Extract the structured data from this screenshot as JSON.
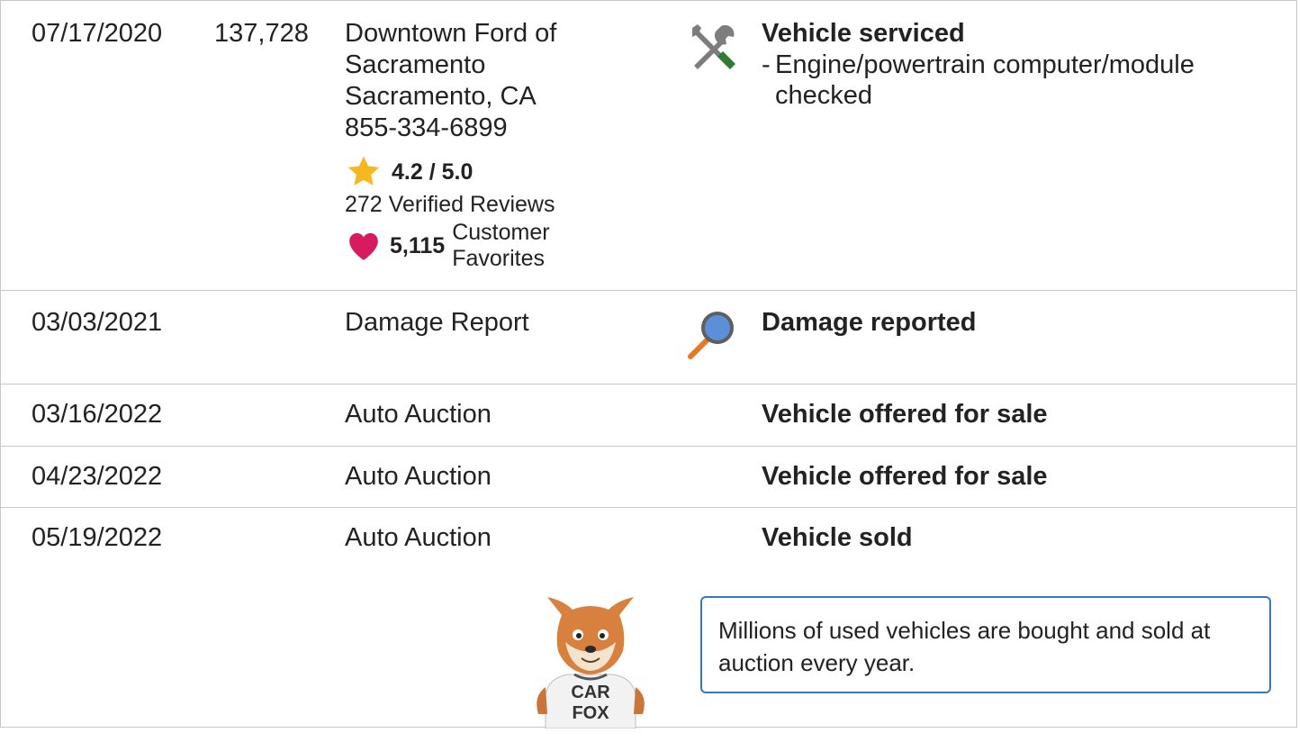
{
  "rows": [
    {
      "date": "07/17/2020",
      "mileage": "137,728",
      "source": {
        "name_line1": "Downtown Ford of",
        "name_line2": "Sacramento",
        "location": "Sacramento, CA",
        "phone": "855-334-6899",
        "rating": "4.2 / 5.0",
        "reviews": "272 Verified Reviews",
        "favorites_count": "5,115",
        "favorites_label_1": "Customer",
        "favorites_label_2": "Favorites"
      },
      "icon": "wrench-screwdriver-icon",
      "title": "Vehicle serviced",
      "detail_dash": "-",
      "detail": "Engine/powertrain computer/module checked"
    },
    {
      "date": "03/03/2021",
      "mileage": "",
      "source": "Damage Report",
      "icon": "magnifier-icon",
      "title": "Damage reported"
    },
    {
      "date": "03/16/2022",
      "mileage": "",
      "source": "Auto Auction",
      "title": "Vehicle offered for sale"
    },
    {
      "date": "04/23/2022",
      "mileage": "",
      "source": "Auto Auction",
      "title": "Vehicle offered for sale"
    },
    {
      "date": "05/19/2022",
      "mileage": "",
      "source": "Auto Auction",
      "title": "Vehicle sold"
    }
  ],
  "callout": "Millions of used vehicles are bought and sold at auction every year.",
  "mascot": {
    "shirt_line1": "CAR",
    "shirt_line2": "FOX"
  },
  "colors": {
    "border": "#c8c8c8",
    "callout_border": "#3777bc",
    "star": "#f5b820",
    "heart": "#d81b60",
    "wrench_green": "#2e7d32",
    "magnifier_blue": "#5b8fd8",
    "magnifier_handle": "#e87722"
  }
}
